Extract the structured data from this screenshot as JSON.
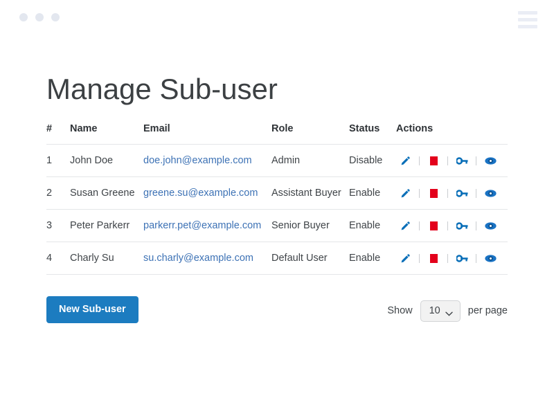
{
  "window": {
    "dots": [
      "dot-1",
      "dot-2",
      "dot-3"
    ],
    "menu_icon": "hamburger-icon"
  },
  "page": {
    "title": "Manage Sub-user"
  },
  "colors": {
    "accent_blue": "#1c7cc0",
    "link_blue": "#3d72b5",
    "icon_blue": "#0a6fb8",
    "danger_red": "#e3001b",
    "border_gray": "#e4e6e8",
    "chrome_gray": "#e3e7ef"
  },
  "table": {
    "columns": [
      "#",
      "Name",
      "Email",
      "Role",
      "Status",
      "Actions"
    ],
    "rows": [
      {
        "num": "1",
        "name": "John Doe",
        "email": "doe.john@example.com",
        "role": "Admin",
        "status": "Disable"
      },
      {
        "num": "2",
        "name": "Susan Greene",
        "email": "greene.su@example.com",
        "role": "Assistant Buyer",
        "status": "Enable"
      },
      {
        "num": "3",
        "name": "Peter Parkerr",
        "email": "parkerr.pet@example.com",
        "role": "Senior Buyer",
        "status": "Enable"
      },
      {
        "num": "4",
        "name": "Charly Su",
        "email": "su.charly@example.com",
        "role": "Default User",
        "status": "Enable"
      }
    ],
    "action_icons": [
      "edit-pencil-icon",
      "delete-trash-icon",
      "key-icon",
      "view-eye-icon"
    ]
  },
  "footer": {
    "new_user_button": "New Sub-user",
    "show_label": "Show",
    "per_page_value": "10",
    "per_page_label": "per page",
    "chevron_icon": "chevron-down-icon"
  }
}
